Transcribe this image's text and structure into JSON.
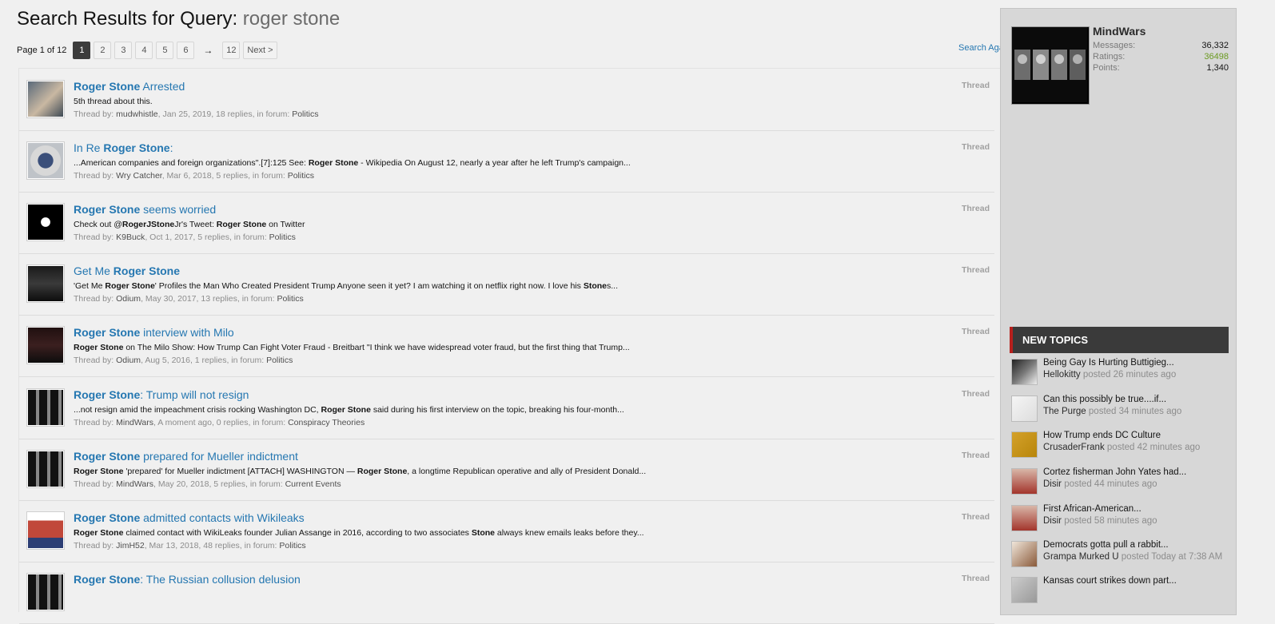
{
  "header": {
    "title_prefix": "Search Results for Query:",
    "query": "roger stone"
  },
  "pagination": {
    "info": "Page 1 of 12",
    "pages": [
      "1",
      "2",
      "3",
      "4",
      "5",
      "6"
    ],
    "arrow": "→",
    "last": "12",
    "next": "Next >"
  },
  "search_again": "Search Again",
  "results": [
    {
      "title": [
        {
          "t": "Roger Stone",
          "b": true
        },
        {
          "t": " Arrested",
          "b": false
        }
      ],
      "snippet": [
        {
          "t": "5th thread about this.",
          "b": false
        }
      ],
      "by": "Thread by:",
      "user": "mudwhistle",
      "info": ", Jan 25, 2019, 18 replies, in forum:",
      "forum": "Politics",
      "type": "Thread"
    },
    {
      "title": [
        {
          "t": "In Re ",
          "b": false
        },
        {
          "t": "Roger Stone",
          "b": true
        },
        {
          "t": ":",
          "b": false
        }
      ],
      "snippet": [
        {
          "t": "...American companies and foreign organizations\".[7]:125 See: ",
          "b": false
        },
        {
          "t": "Roger Stone",
          "b": true
        },
        {
          "t": " - Wikipedia On August 12, nearly a year after he left Trump's campaign...",
          "b": false
        }
      ],
      "by": "Thread by:",
      "user": "Wry Catcher",
      "info": ", Mar 6, 2018, 5 replies, in forum:",
      "forum": "Politics",
      "type": "Thread"
    },
    {
      "title": [
        {
          "t": "Roger Stone",
          "b": true
        },
        {
          "t": " seems worried",
          "b": false
        }
      ],
      "snippet": [
        {
          "t": "Check out @",
          "b": false
        },
        {
          "t": "RogerJStone",
          "b": true
        },
        {
          "t": "Jr's Tweet: ",
          "b": false
        },
        {
          "t": "Roger Stone",
          "b": true
        },
        {
          "t": " on Twitter",
          "b": false
        }
      ],
      "by": "Thread by:",
      "user": "K9Buck",
      "info": ", Oct 1, 2017, 5 replies, in forum:",
      "forum": "Politics",
      "type": "Thread"
    },
    {
      "title": [
        {
          "t": "Get Me ",
          "b": false
        },
        {
          "t": "Roger Stone",
          "b": true
        }
      ],
      "snippet": [
        {
          "t": "'Get Me ",
          "b": false
        },
        {
          "t": "Roger Stone",
          "b": true
        },
        {
          "t": "' Profiles the Man Who Created President Trump Anyone seen it yet? I am watching it on netflix right now. I love his ",
          "b": false
        },
        {
          "t": "Stone",
          "b": true
        },
        {
          "t": "s...",
          "b": false
        }
      ],
      "by": "Thread by:",
      "user": "Odium",
      "info": ", May 30, 2017, 13 replies, in forum:",
      "forum": "Politics",
      "type": "Thread"
    },
    {
      "title": [
        {
          "t": "Roger Stone",
          "b": true
        },
        {
          "t": " interview with Milo",
          "b": false
        }
      ],
      "snippet": [
        {
          "t": "Roger Stone",
          "b": true
        },
        {
          "t": " on The Milo Show: How Trump Can Fight Voter Fraud - Breitbart \"I think we have widespread voter fraud, but the first thing that Trump...",
          "b": false
        }
      ],
      "by": "Thread by:",
      "user": "Odium",
      "info": ", Aug 5, 2016, 1 replies, in forum:",
      "forum": "Politics",
      "type": "Thread"
    },
    {
      "title": [
        {
          "t": "Roger Stone",
          "b": true
        },
        {
          "t": ": Trump will not resign",
          "b": false
        }
      ],
      "snippet": [
        {
          "t": "...not resign amid the impeachment crisis rocking Washington DC, ",
          "b": false
        },
        {
          "t": "Roger Stone",
          "b": true
        },
        {
          "t": " said during his first interview on the topic, breaking his four-month...",
          "b": false
        }
      ],
      "by": "Thread by:",
      "user": "MindWars",
      "info": ", A moment ago, 0 replies, in forum:",
      "forum": "Conspiracy Theories",
      "type": "Thread"
    },
    {
      "title": [
        {
          "t": "Roger Stone",
          "b": true
        },
        {
          "t": " prepared for Mueller indictment",
          "b": false
        }
      ],
      "snippet": [
        {
          "t": "Roger Stone",
          "b": true
        },
        {
          "t": " 'prepared' for Mueller indictment [ATTACH] WASHINGTON — ",
          "b": false
        },
        {
          "t": "Roger Stone",
          "b": true
        },
        {
          "t": ", a longtime Republican operative and ally of President Donald...",
          "b": false
        }
      ],
      "by": "Thread by:",
      "user": "MindWars",
      "info": ", May 20, 2018, 5 replies, in forum:",
      "forum": "Current Events",
      "type": "Thread"
    },
    {
      "title": [
        {
          "t": "Roger Stone",
          "b": true
        },
        {
          "t": " admitted contacts with Wikileaks",
          "b": false
        }
      ],
      "snippet": [
        {
          "t": "Roger Stone",
          "b": true
        },
        {
          "t": " claimed contact with WikiLeaks founder Julian Assange in 2016, according to two associates ",
          "b": false
        },
        {
          "t": "Stone",
          "b": true
        },
        {
          "t": " always knew emails leaks before they...",
          "b": false
        }
      ],
      "by": "Thread by:",
      "user": "JimH52",
      "info": ", Mar 13, 2018, 48 replies, in forum:",
      "forum": "Politics",
      "type": "Thread"
    },
    {
      "title": [
        {
          "t": "Roger Stone",
          "b": true
        },
        {
          "t": ": The Russian collusion delusion",
          "b": false
        }
      ],
      "snippet": [],
      "by": "",
      "user": "",
      "info": "",
      "forum": "",
      "type": "Thread"
    }
  ],
  "sidebar": {
    "username": "MindWars",
    "stats": [
      {
        "label": "Messages:",
        "value": "36,332"
      },
      {
        "label": "Ratings:",
        "value": "36498"
      },
      {
        "label": "Points:",
        "value": "1,340"
      }
    ],
    "new_topics_title": "NEW TOPICS",
    "topics": [
      {
        "title": "Being Gay Is Hurting Buttigieg...",
        "user": "Hellokitty",
        "time": " posted 26 minutes ago"
      },
      {
        "title": "Can this possibly be true....if...",
        "user": "The Purge",
        "time": " posted 34 minutes ago"
      },
      {
        "title": "How Trump ends DC Culture",
        "user": "CrusaderFrank",
        "time": " posted 42 minutes ago"
      },
      {
        "title": "Cortez fisherman John Yates had...",
        "user": "Disir",
        "time": " posted 44 minutes ago"
      },
      {
        "title": "First African-American...",
        "user": "Disir",
        "time": " posted 58 minutes ago"
      },
      {
        "title": "Democrats gotta pull a rabbit...",
        "user": "Grampa Murked U",
        "time": " posted Today at 7:38 AM"
      },
      {
        "title": "Kansas court strikes down part...",
        "user": "",
        "time": ""
      }
    ]
  },
  "colors": {
    "link": "#2577b1",
    "accent_red": "#b8201d",
    "ratings_green": "#6b9a21"
  }
}
